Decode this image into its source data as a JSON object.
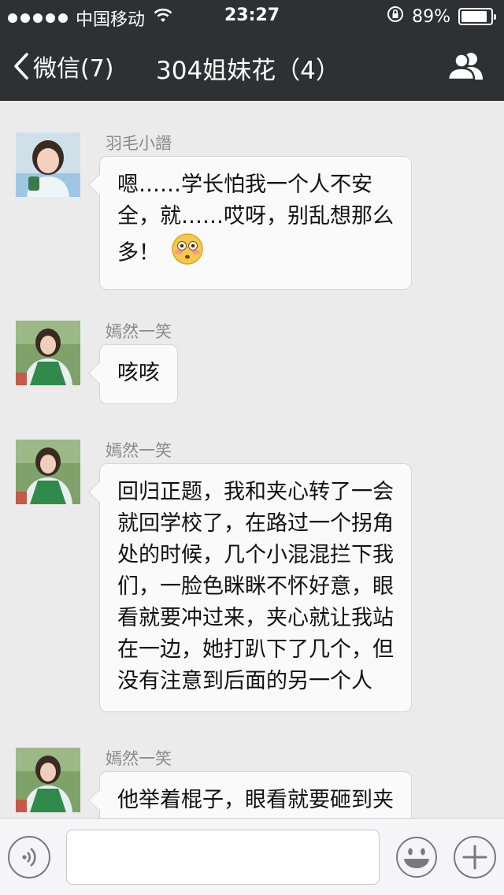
{
  "status_bar": {
    "carrier": "中国移动",
    "time": "23:27",
    "battery_percent": "89%",
    "battery_level": 0.89
  },
  "nav": {
    "back_label": "微信(7)",
    "title": "304姐妹花（4）",
    "back_icon": "chevron-left-icon",
    "group_icon": "group-members-icon"
  },
  "messages": [
    {
      "sender": "羽毛小譖",
      "text": "嗯……学长怕我一个人不安\n全，就……哎呀，别乱想那么\n多！",
      "emoji": "flushed-face-emoji"
    },
    {
      "sender": "嫣然一笑",
      "text": "咳咳"
    },
    {
      "sender": "嫣然一笑",
      "text": "回归正题，我和夹心转了一会\n就回学校了，在路过一个拐角\n处的时候，几个小混混拦下我\n们，一脸色眯眯不怀好意，眼\n看就要冲过来，夹心就让我站\n在一边，她打趴下了几个，但\n没有注意到后面的另一个人"
    },
    {
      "sender": "嫣然一笑",
      "text": "他举着棍子，眼看就要砸到夹"
    }
  ],
  "input_bar": {
    "voice_icon": "voice-input-icon",
    "emoji_icon": "emoji-icon",
    "plus_icon": "plus-icon",
    "text_value": ""
  },
  "colors": {
    "header_bg": "#2e3034",
    "chat_bg": "#ebebeb",
    "bubble_bg": "#fafafa"
  }
}
